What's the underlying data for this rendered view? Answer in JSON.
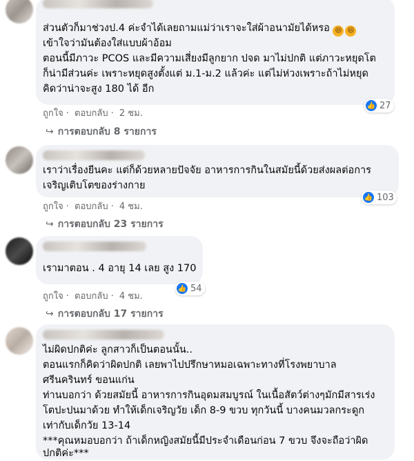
{
  "comments": [
    {
      "lines": [
        "ส่วนตัวก็มาช่วงป.4 ค่ะจำได้เลยถามแม่ว่าเราจะใส่ผ้าอนามัยได้หรอ",
        "เข้าใจว่ามันต้องใส่แบบผ้าอ้อม",
        "ตอนนี้มีภาวะ PCOS และมีความเสี่ยงมีลูกยาก ปจด มาไม่ปกติ แต่ภาวะหยุดโต",
        "ก็น่ามีส่วนค่ะ เพราะหยุดสูงตั้งแต่ ม.1-ม.2 แล้วค่ะ แต่ไม่ห่วงเพราะถ้าไม่หยุด",
        "คิดว่าน่าจะสูง 180 ได้ อีก"
      ],
      "like": "ถูกใจ",
      "reply": "ตอบกลับ",
      "time": "2 ชม.",
      "reactions": "27",
      "replies": "การตอบกลับ 8 รายการ",
      "emoji": "rolling-laughing-icon"
    },
    {
      "lines": [
        "เราว่าเรื่องยีนคะ แต่ก็ด้วยหลายปัจจัย อาหารการกินในสมัยนี้ด้วยส่งผลต่อการ",
        "เจริญเติบโตของร่างกาย"
      ],
      "like": "ถูกใจ",
      "reply": "ตอบกลับ",
      "time": "4 ชม.",
      "reactions": "103",
      "replies": "การตอบกลับ 23 รายการ"
    },
    {
      "lines": [
        "เรามาตอน . 4 อายุ 14 เลย สูง 170"
      ],
      "like": "ถูกใจ",
      "reply": "ตอบกลับ",
      "time": "4 ชม.",
      "reactions": "54",
      "replies": "การตอบกลับ 17 รายการ"
    },
    {
      "lines": [
        "ไม่ผิดปกติค่ะ ลูกสาวก็เป็นตอนนั้น..",
        "ตอนแรกก็คิดว่าผิดปกติ เลยพาไปปรึกษาหมอเฉพาะทางที่โรงพยาบาล",
        "ศรีนครินทร์ ขอนแก่น",
        "ท่านบอกว่า ด้วยสมัยนี้ อาหารการกินอุดมสมบูรณ์ ในเนื้อสัตว์ต่างๆมักมีสารเร่ง",
        "โตปะปนมาด้วย ทำให้เด็กเจริญวัย เด็ก 8-9 ขวบ ทุกวันนี้ บางคนมวลกระดูก",
        "เท่ากับเด็กวัย 13-14",
        "***คุณหมอบอกว่า ถ้าเด็กหญิงสมัยนี้มีประจำเดือนก่อน 7 ขวบ จึงจะถือว่าผิด",
        "ปกติค่ะ***"
      ]
    }
  ],
  "colors": {
    "bubble": "#f0f2f5",
    "like_blue": "#1877f2",
    "meta_gray": "#65676b"
  },
  "icons": {
    "reply_arrow": "reply-arrow-icon",
    "like_badge": "like-thumb-icon"
  }
}
